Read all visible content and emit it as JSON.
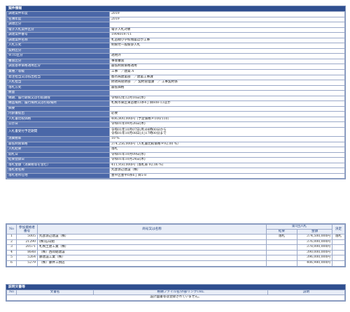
{
  "detail": {
    "header": "案件情報",
    "rows": [
      {
        "label": "調達案件年度",
        "value": "2019"
      },
      {
        "label": "名簿年度",
        "value": "2019"
      },
      {
        "label": "調達区分",
        "value": ""
      },
      {
        "label": "電子入札案件区分",
        "value": "電子入札対象"
      },
      {
        "label": "調達案件番号",
        "value": "1904019711"
      },
      {
        "label": "調達案件名称",
        "value": "札苗緑小学校増築ほか工事"
      },
      {
        "label": "入札方式",
        "value": "制限付一般競争入札"
      },
      {
        "label": "契約区分",
        "value": ""
      },
      {
        "label": "WTO区分",
        "value": "適用外"
      },
      {
        "label": "審査区分",
        "value": "事後審査"
      },
      {
        "label": "調査基準価格適用区分",
        "value": "最低制限価格適用"
      },
      {
        "label": "業種／等級",
        "value": "工事　／建築 A"
      },
      {
        "label": "発注担当又は払出担当",
        "value": "都市局建築部　／建築工事課"
      },
      {
        "label": "入札担当",
        "value": "財政局管財部　／ 契約管理課　／ 工事契約係"
      },
      {
        "label": "落札方式",
        "value": "最低価格"
      },
      {
        "label": "数量",
        "value": ""
      },
      {
        "label": "納期、履行期限又は引取期限",
        "value": "令和02年12月16日(水)"
      },
      {
        "label": "納品場所、履行場所又は引取場所",
        "value": "札幌市東区東苗穂13条4丁目608-13ほか"
      },
      {
        "label": "摘要",
        "value": ""
      },
      {
        "label": "内訳書提出",
        "value": "必要"
      },
      {
        "label": "入札書比較価格",
        "value": "406,800,000円（予定価格＊100/110）"
      },
      {
        "label": "公示日",
        "value": "令和01年09月26日(木)"
      },
      {
        "label": "入札書受付予定期間",
        "value": "令和01年10月07日(月)08時00分から\n令和01年10月08日(火)17時00分まで"
      },
      {
        "label": "消費税率",
        "value": "10 %"
      },
      {
        "label": "最低制限価格",
        "value": "374,256,000円（入札書比較価格＊92.00 %）"
      },
      {
        "label": "入札結果",
        "value": "落札"
      },
      {
        "label": "開札日",
        "value": "令和01年10月09日(水)"
      },
      {
        "label": "結果登録日",
        "value": "令和01年10月24日(木)"
      },
      {
        "label": "落札金額（消費税等を含む）",
        "value": "411,950,000円（落札率 92.06 %）"
      },
      {
        "label": "落札者名称",
        "value": "丸彦渡辺建設（株）"
      },
      {
        "label": "落札者所在地",
        "value": "豊平区豊平6条6丁目5-8"
      }
    ]
  },
  "results": {
    "headers": {
      "no": "No",
      "bidder_no": "参加資格者番号",
      "name": "商号又は名称",
      "round1": "第1回入札",
      "result": "結果",
      "amount": "金額",
      "decision": "決定"
    },
    "rows": [
      {
        "no": "1",
        "bidder_no": "5005",
        "name": "丸彦渡辺建設（株）",
        "result": "落札",
        "amount": "374,500,000円",
        "decision": "落札"
      },
      {
        "no": "2",
        "bidder_no": "21290",
        "name": "(株)石山組",
        "result": "",
        "amount": "376,000,000円",
        "decision": ""
      },
      {
        "no": "3",
        "bidder_no": "20571",
        "name": "札幌土建工業（株）",
        "result": "",
        "amount": "378,000,000円",
        "decision": ""
      },
      {
        "no": "4",
        "bidder_no": "8648",
        "name": "（株）西岡組建設",
        "result": "",
        "amount": "390,000,000円",
        "decision": ""
      },
      {
        "no": "5",
        "bidder_no": "5264",
        "name": "藤建設工業（株）",
        "result": "",
        "amount": "396,000,000円",
        "decision": ""
      },
      {
        "no": "6",
        "bidder_no": "5279",
        "name": "（株）藤井工務店",
        "result": "",
        "amount": "406,980,000円",
        "decision": ""
      }
    ]
  },
  "documents": {
    "header": "説明文書等",
    "columns": {
      "no": "No",
      "name": "文書名",
      "file": "格納ファイル名/外部リンクURL",
      "desc": "説明"
    },
    "empty_message": "設計図書等は登録されていません。"
  }
}
